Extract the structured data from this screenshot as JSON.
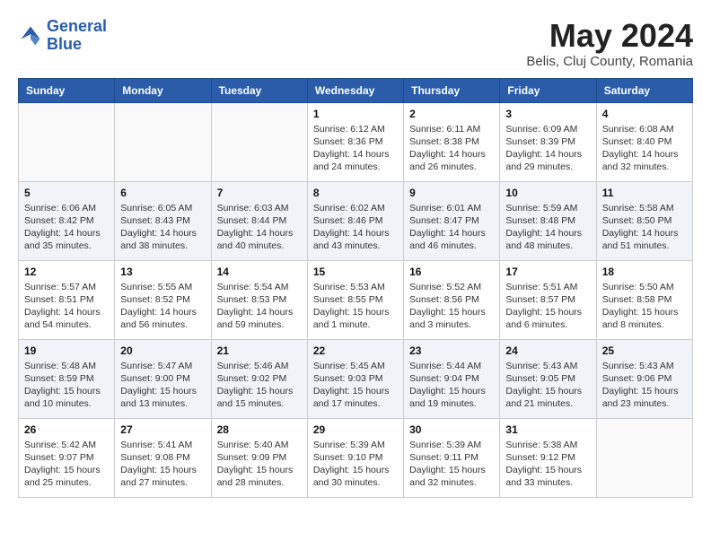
{
  "header": {
    "logo_line1": "General",
    "logo_line2": "Blue",
    "month_year": "May 2024",
    "location": "Belis, Cluj County, Romania"
  },
  "days_of_week": [
    "Sunday",
    "Monday",
    "Tuesday",
    "Wednesday",
    "Thursday",
    "Friday",
    "Saturday"
  ],
  "weeks": [
    [
      {
        "day": "",
        "info": ""
      },
      {
        "day": "",
        "info": ""
      },
      {
        "day": "",
        "info": ""
      },
      {
        "day": "1",
        "info": "Sunrise: 6:12 AM\nSunset: 8:36 PM\nDaylight: 14 hours\nand 24 minutes."
      },
      {
        "day": "2",
        "info": "Sunrise: 6:11 AM\nSunset: 8:38 PM\nDaylight: 14 hours\nand 26 minutes."
      },
      {
        "day": "3",
        "info": "Sunrise: 6:09 AM\nSunset: 8:39 PM\nDaylight: 14 hours\nand 29 minutes."
      },
      {
        "day": "4",
        "info": "Sunrise: 6:08 AM\nSunset: 8:40 PM\nDaylight: 14 hours\nand 32 minutes."
      }
    ],
    [
      {
        "day": "5",
        "info": "Sunrise: 6:06 AM\nSunset: 8:42 PM\nDaylight: 14 hours\nand 35 minutes."
      },
      {
        "day": "6",
        "info": "Sunrise: 6:05 AM\nSunset: 8:43 PM\nDaylight: 14 hours\nand 38 minutes."
      },
      {
        "day": "7",
        "info": "Sunrise: 6:03 AM\nSunset: 8:44 PM\nDaylight: 14 hours\nand 40 minutes."
      },
      {
        "day": "8",
        "info": "Sunrise: 6:02 AM\nSunset: 8:46 PM\nDaylight: 14 hours\nand 43 minutes."
      },
      {
        "day": "9",
        "info": "Sunrise: 6:01 AM\nSunset: 8:47 PM\nDaylight: 14 hours\nand 46 minutes."
      },
      {
        "day": "10",
        "info": "Sunrise: 5:59 AM\nSunset: 8:48 PM\nDaylight: 14 hours\nand 48 minutes."
      },
      {
        "day": "11",
        "info": "Sunrise: 5:58 AM\nSunset: 8:50 PM\nDaylight: 14 hours\nand 51 minutes."
      }
    ],
    [
      {
        "day": "12",
        "info": "Sunrise: 5:57 AM\nSunset: 8:51 PM\nDaylight: 14 hours\nand 54 minutes."
      },
      {
        "day": "13",
        "info": "Sunrise: 5:55 AM\nSunset: 8:52 PM\nDaylight: 14 hours\nand 56 minutes."
      },
      {
        "day": "14",
        "info": "Sunrise: 5:54 AM\nSunset: 8:53 PM\nDaylight: 14 hours\nand 59 minutes."
      },
      {
        "day": "15",
        "info": "Sunrise: 5:53 AM\nSunset: 8:55 PM\nDaylight: 15 hours\nand 1 minute."
      },
      {
        "day": "16",
        "info": "Sunrise: 5:52 AM\nSunset: 8:56 PM\nDaylight: 15 hours\nand 3 minutes."
      },
      {
        "day": "17",
        "info": "Sunrise: 5:51 AM\nSunset: 8:57 PM\nDaylight: 15 hours\nand 6 minutes."
      },
      {
        "day": "18",
        "info": "Sunrise: 5:50 AM\nSunset: 8:58 PM\nDaylight: 15 hours\nand 8 minutes."
      }
    ],
    [
      {
        "day": "19",
        "info": "Sunrise: 5:48 AM\nSunset: 8:59 PM\nDaylight: 15 hours\nand 10 minutes."
      },
      {
        "day": "20",
        "info": "Sunrise: 5:47 AM\nSunset: 9:00 PM\nDaylight: 15 hours\nand 13 minutes."
      },
      {
        "day": "21",
        "info": "Sunrise: 5:46 AM\nSunset: 9:02 PM\nDaylight: 15 hours\nand 15 minutes."
      },
      {
        "day": "22",
        "info": "Sunrise: 5:45 AM\nSunset: 9:03 PM\nDaylight: 15 hours\nand 17 minutes."
      },
      {
        "day": "23",
        "info": "Sunrise: 5:44 AM\nSunset: 9:04 PM\nDaylight: 15 hours\nand 19 minutes."
      },
      {
        "day": "24",
        "info": "Sunrise: 5:43 AM\nSunset: 9:05 PM\nDaylight: 15 hours\nand 21 minutes."
      },
      {
        "day": "25",
        "info": "Sunrise: 5:43 AM\nSunset: 9:06 PM\nDaylight: 15 hours\nand 23 minutes."
      }
    ],
    [
      {
        "day": "26",
        "info": "Sunrise: 5:42 AM\nSunset: 9:07 PM\nDaylight: 15 hours\nand 25 minutes."
      },
      {
        "day": "27",
        "info": "Sunrise: 5:41 AM\nSunset: 9:08 PM\nDaylight: 15 hours\nand 27 minutes."
      },
      {
        "day": "28",
        "info": "Sunrise: 5:40 AM\nSunset: 9:09 PM\nDaylight: 15 hours\nand 28 minutes."
      },
      {
        "day": "29",
        "info": "Sunrise: 5:39 AM\nSunset: 9:10 PM\nDaylight: 15 hours\nand 30 minutes."
      },
      {
        "day": "30",
        "info": "Sunrise: 5:39 AM\nSunset: 9:11 PM\nDaylight: 15 hours\nand 32 minutes."
      },
      {
        "day": "31",
        "info": "Sunrise: 5:38 AM\nSunset: 9:12 PM\nDaylight: 15 hours\nand 33 minutes."
      },
      {
        "day": "",
        "info": ""
      }
    ]
  ]
}
